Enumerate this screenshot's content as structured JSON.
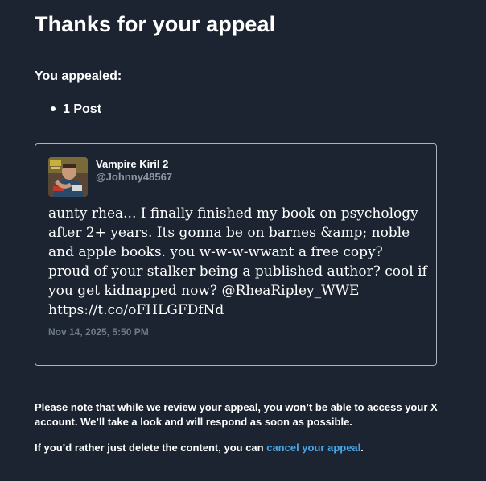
{
  "header": {
    "title": "Thanks for your appeal"
  },
  "appeal_summary": {
    "label": "You appealed:",
    "items": [
      "1 Post"
    ]
  },
  "post": {
    "display_name": "Vampire Kiril 2",
    "handle": "@Johnny48567",
    "text": "aunty rhea... I finally finished my book on psychology after 2+ years. Its gonna be on barnes &amp; noble and apple books. you w-w-w-wwant a free copy? proud of your stalker being a published author? cool if you get kidnapped now? @RheaRipley_WWE https://t.co/oFHLGFDfNd",
    "timestamp": "Nov 14, 2025, 5:50 PM",
    "avatar_icon": "user-avatar-photo"
  },
  "footer": {
    "review_note": "Please note that while we review your appeal, you won’t be able to access your X account. We’ll take a look and will respond as soon as possible.",
    "delete_prefix": "If you’d rather just delete the content, you can ",
    "cancel_link": "cancel your appeal",
    "delete_suffix": "."
  },
  "colors": {
    "background": "#1b2430",
    "link": "#4aa6e6",
    "muted": "#8b98a5",
    "border": "#a9b2bd"
  }
}
